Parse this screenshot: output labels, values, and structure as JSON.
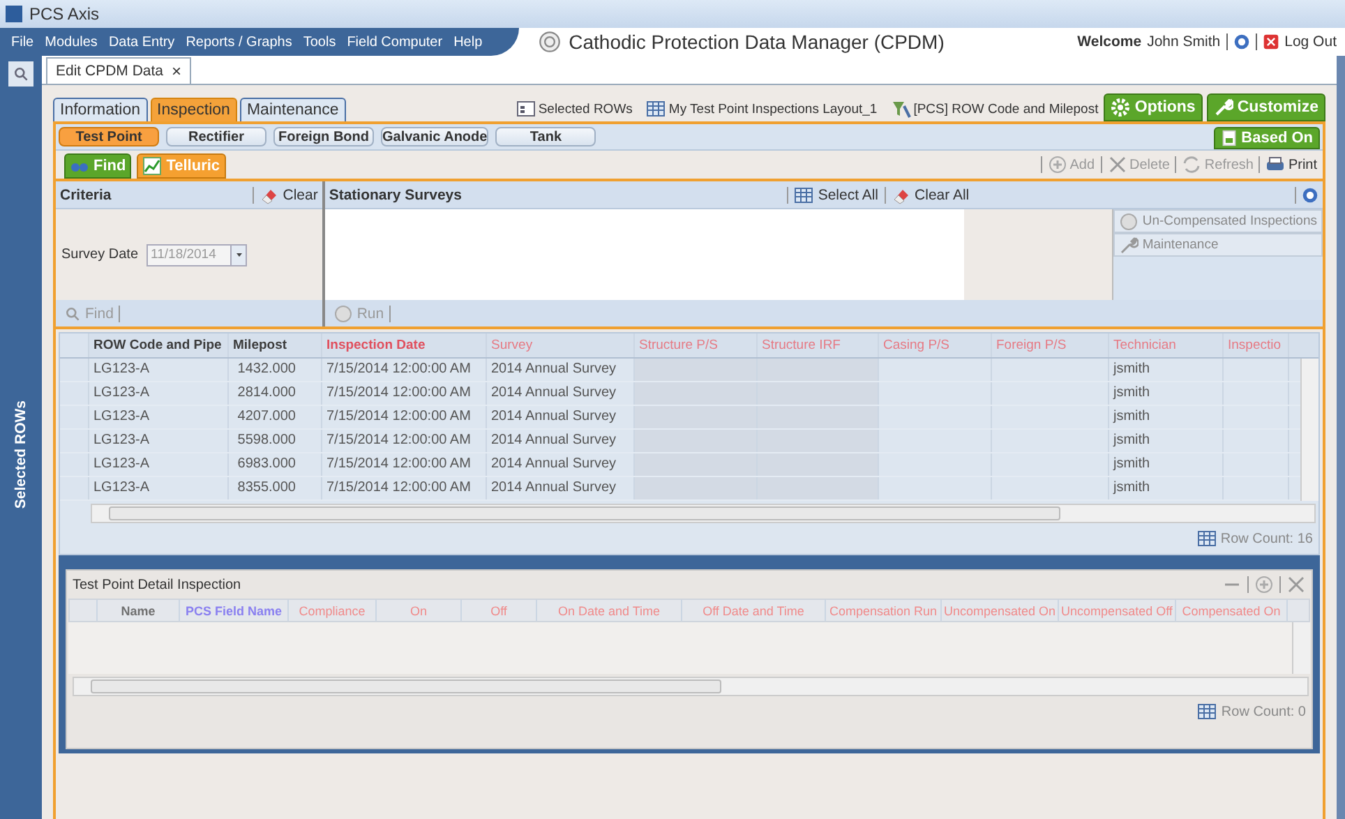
{
  "window": {
    "title": "PCS Axis"
  },
  "menu": [
    "File",
    "Modules",
    "Data Entry",
    "Reports / Graphs",
    "Tools",
    "Field Computer",
    "Help"
  ],
  "app_title": "Cathodic Protection Data Manager (CPDM)",
  "user": {
    "welcome": "Welcome",
    "name": "John Smith",
    "logout": "Log Out"
  },
  "sidebar": {
    "label": "Selected ROWs"
  },
  "doc_tab": {
    "label": "Edit CPDM Data",
    "close": "×"
  },
  "module_tabs": [
    {
      "label": "Information",
      "selected": false
    },
    {
      "label": "Inspection",
      "selected": true
    },
    {
      "label": "Maintenance",
      "selected": false
    }
  ],
  "context_links": [
    {
      "kind": "rows",
      "label": "Selected ROWs"
    },
    {
      "kind": "layout",
      "label": "My Test Point Inspections Layout_1"
    },
    {
      "kind": "filter",
      "label": "[PCS] ROW Code and Milepost"
    }
  ],
  "top_buttons": [
    {
      "kind": "options",
      "label": "Options"
    },
    {
      "kind": "customize",
      "label": "Customize"
    }
  ],
  "sub_tabs": [
    {
      "label": "Test Point",
      "selected": true
    },
    {
      "label": "Rectifier",
      "selected": false
    },
    {
      "label": "Foreign Bond",
      "selected": false
    },
    {
      "label": "Galvanic Anode",
      "selected": false
    },
    {
      "label": "Tank",
      "selected": false
    }
  ],
  "based_on": "Based On",
  "mode_tabs": [
    {
      "kind": "find",
      "label": "Find",
      "selected": false
    },
    {
      "kind": "telluric",
      "label": "Telluric",
      "selected": true
    }
  ],
  "toolbar": [
    {
      "kind": "add",
      "label": "Add",
      "disabled": true
    },
    {
      "kind": "delete",
      "label": "Delete",
      "disabled": true
    },
    {
      "kind": "refresh",
      "label": "Refresh",
      "disabled": true
    },
    {
      "kind": "print",
      "label": "Print",
      "disabled": false
    }
  ],
  "criteria": {
    "title": "Criteria",
    "clear": "Clear",
    "field_label": "Survey Date",
    "field_value": "11/18/2014",
    "find": "Find"
  },
  "surveys": {
    "title": "Stationary Surveys",
    "select_all": "Select All",
    "clear_all": "Clear All",
    "run": "Run"
  },
  "side_actions": [
    {
      "kind": "circle",
      "label": "Un-Compensated Inspections",
      "disabled": true
    },
    {
      "kind": "wrench",
      "label": "Maintenance",
      "disabled": true
    }
  ],
  "grid": {
    "columns": [
      {
        "label": "ROW Code and Pipe",
        "color": "#3c3c3c",
        "bold": true,
        "shaded": false
      },
      {
        "label": "Milepost",
        "color": "#3c3c3c",
        "bold": true,
        "shaded": false
      },
      {
        "label": "Inspection Date",
        "color": "#e0505e",
        "bold": true,
        "shaded": false
      },
      {
        "label": "Survey",
        "color": "#e67a84",
        "bold": false,
        "shaded": false
      },
      {
        "label": "Structure P/S",
        "color": "#e67a84",
        "bold": false,
        "shaded": true
      },
      {
        "label": "Structure IRF",
        "color": "#e67a84",
        "bold": false,
        "shaded": true
      },
      {
        "label": "Casing P/S",
        "color": "#e67a84",
        "bold": false,
        "shaded": false
      },
      {
        "label": "Foreign P/S",
        "color": "#e67a84",
        "bold": false,
        "shaded": false
      },
      {
        "label": "Technician",
        "color": "#e67a84",
        "bold": false,
        "shaded": false
      },
      {
        "label": "Inspectio",
        "color": "#e67a84",
        "bold": false,
        "shaded": false
      }
    ],
    "rows": [
      {
        "cells": [
          "LG123-A",
          "1432.000",
          "7/15/2014 12:00:00 AM",
          "2014 Annual Survey",
          null,
          null,
          null,
          null,
          "jsmith",
          null
        ]
      },
      {
        "cells": [
          "LG123-A",
          "2814.000",
          "7/15/2014 12:00:00 AM",
          "2014 Annual Survey",
          null,
          null,
          null,
          null,
          "jsmith",
          null
        ]
      },
      {
        "cells": [
          "LG123-A",
          "4207.000",
          "7/15/2014 12:00:00 AM",
          "2014 Annual Survey",
          null,
          null,
          null,
          null,
          "jsmith",
          null
        ]
      },
      {
        "cells": [
          "LG123-A",
          "5598.000",
          "7/15/2014 12:00:00 AM",
          "2014 Annual Survey",
          null,
          null,
          null,
          null,
          "jsmith",
          null
        ]
      },
      {
        "cells": [
          "LG123-A",
          "6983.000",
          "7/15/2014 12:00:00 AM",
          "2014 Annual Survey",
          null,
          null,
          null,
          null,
          "jsmith",
          null
        ]
      },
      {
        "cells": [
          "LG123-A",
          "8355.000",
          "7/15/2014 12:00:00 AM",
          "2014 Annual Survey",
          null,
          null,
          null,
          null,
          "jsmith",
          null
        ]
      }
    ],
    "row_count": "Row Count: 16"
  },
  "detail": {
    "title": "Test Point Detail Inspection",
    "columns": [
      {
        "label": "Name",
        "color": "#707070",
        "bold": true
      },
      {
        "label": "PCS Field Name",
        "color": "#8a80f0",
        "bold": true
      },
      {
        "label": "Compliance",
        "color": "#f08a8a",
        "bold": false
      },
      {
        "label": "On",
        "color": "#f08a8a",
        "bold": false
      },
      {
        "label": "Off",
        "color": "#f08a8a",
        "bold": false
      },
      {
        "label": "On Date and Time",
        "color": "#f08a8a",
        "bold": false
      },
      {
        "label": "Off Date and Time",
        "color": "#f08a8a",
        "bold": false
      },
      {
        "label": "Compensation Run",
        "color": "#f08a8a",
        "bold": false
      },
      {
        "label": "Uncompensated On",
        "color": "#f08a8a",
        "bold": false
      },
      {
        "label": "Uncompensated Off",
        "color": "#f08a8a",
        "bold": false
      },
      {
        "label": "Compensated On",
        "color": "#f08a8a",
        "bold": false
      }
    ],
    "row_count": "Row Count: 0"
  }
}
